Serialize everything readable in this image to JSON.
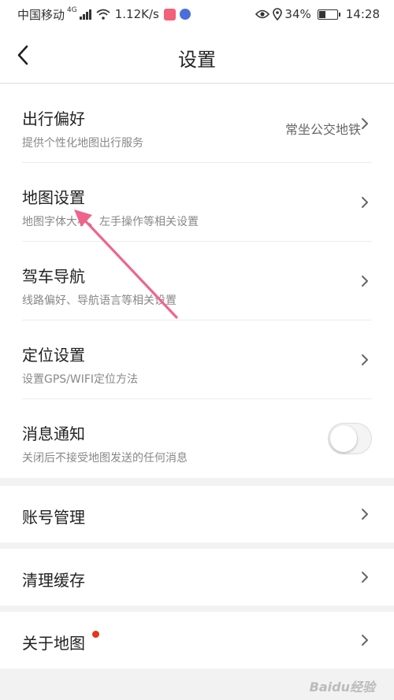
{
  "status_bar": {
    "carrier": "中国移动",
    "network": "4G",
    "speed": "1.12K/s",
    "battery": "34%",
    "time": "14:28"
  },
  "header": {
    "title": "设置"
  },
  "settings": {
    "travel_preference": {
      "title": "出行偏好",
      "subtitle": "提供个性化地图出行服务",
      "value": "常坐公交地铁"
    },
    "map_settings": {
      "title": "地图设置",
      "subtitle": "地图字体大小、左手操作等相关设置"
    },
    "driving_navigation": {
      "title": "驾车导航",
      "subtitle": "线路偏好、导航语言等相关设置"
    },
    "location_settings": {
      "title": "定位设置",
      "subtitle": "设置GPS/WIFI定位方法"
    },
    "notifications": {
      "title": "消息通知",
      "subtitle": "关闭后不接受地图发送的任何消息",
      "enabled": false
    },
    "account_management": {
      "title": "账号管理"
    },
    "clear_cache": {
      "title": "清理缓存"
    },
    "about_map": {
      "title": "关于地图",
      "has_badge": true
    }
  },
  "colors": {
    "annotation_arrow": "#f0648c",
    "badge": "#e8341c",
    "background": "#f2f2f2"
  },
  "watermark": "Baidu经验"
}
